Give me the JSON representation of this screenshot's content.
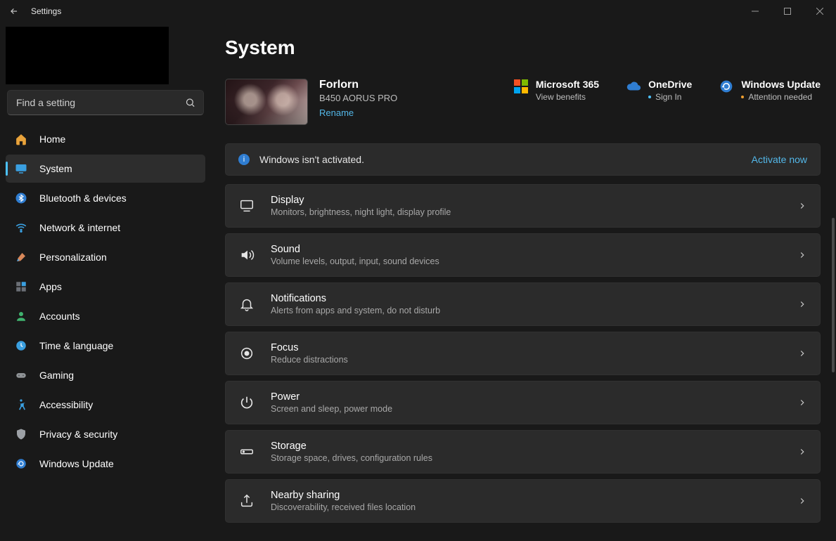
{
  "window": {
    "title": "Settings"
  },
  "search": {
    "placeholder": "Find a setting"
  },
  "sidebar": {
    "items": [
      {
        "label": "Home"
      },
      {
        "label": "System"
      },
      {
        "label": "Bluetooth & devices"
      },
      {
        "label": "Network & internet"
      },
      {
        "label": "Personalization"
      },
      {
        "label": "Apps"
      },
      {
        "label": "Accounts"
      },
      {
        "label": "Time & language"
      },
      {
        "label": "Gaming"
      },
      {
        "label": "Accessibility"
      },
      {
        "label": "Privacy & security"
      },
      {
        "label": "Windows Update"
      }
    ]
  },
  "page": {
    "heading": "System",
    "device": {
      "name": "Forlorn",
      "model": "B450 AORUS PRO",
      "rename": "Rename"
    },
    "quick": {
      "m365": {
        "title": "Microsoft 365",
        "sub": "View benefits"
      },
      "onedrive": {
        "title": "OneDrive",
        "sub": "Sign In"
      },
      "update": {
        "title": "Windows Update",
        "sub": "Attention needed"
      }
    },
    "banner": {
      "message": "Windows isn't activated.",
      "action": "Activate now"
    },
    "cards": [
      {
        "title": "Display",
        "desc": "Monitors, brightness, night light, display profile"
      },
      {
        "title": "Sound",
        "desc": "Volume levels, output, input, sound devices"
      },
      {
        "title": "Notifications",
        "desc": "Alerts from apps and system, do not disturb"
      },
      {
        "title": "Focus",
        "desc": "Reduce distractions"
      },
      {
        "title": "Power",
        "desc": "Screen and sleep, power mode"
      },
      {
        "title": "Storage",
        "desc": "Storage space, drives, configuration rules"
      },
      {
        "title": "Nearby sharing",
        "desc": "Discoverability, received files location"
      }
    ]
  }
}
